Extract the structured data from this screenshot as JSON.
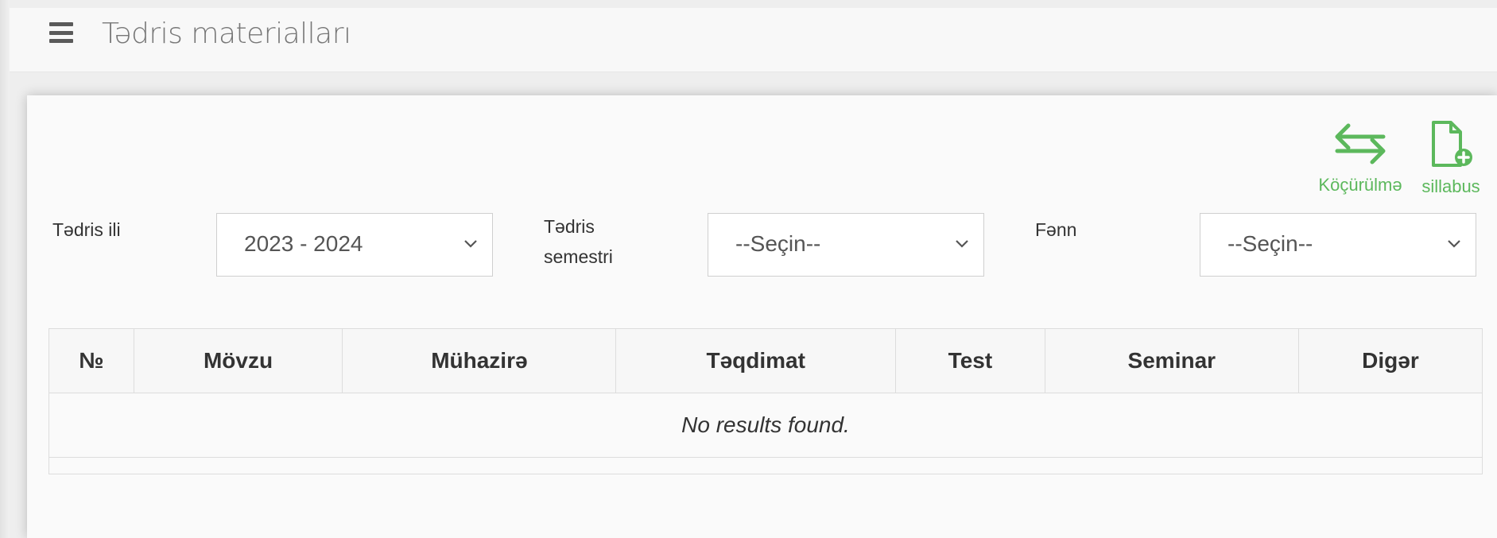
{
  "header": {
    "title": "Tədris materialları"
  },
  "actions": {
    "transfer_label": "Köçürülmə",
    "syllabus_label": "sillabus"
  },
  "colors": {
    "accent": "#5cb85c"
  },
  "filters": {
    "year_label": "Tədris ili",
    "year_value": "2023 - 2024",
    "semester_label_line1": "Tədris",
    "semester_label_line2": "semestri",
    "semester_value": "--Seçin--",
    "subject_label": "Fənn",
    "subject_value": "--Seçin--"
  },
  "table": {
    "columns": [
      "№",
      "Mövzu",
      "Mühazirə",
      "Təqdimat",
      "Test",
      "Seminar",
      "Digər"
    ],
    "empty_message": "No results found."
  }
}
